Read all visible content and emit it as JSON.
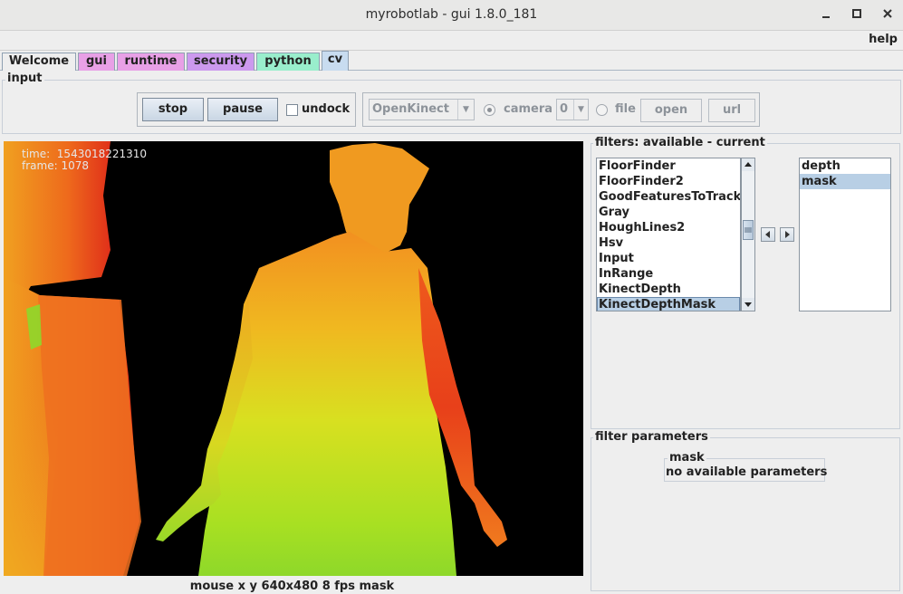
{
  "window": {
    "title": "myrobotlab - gui 1.8.0_181",
    "minimize_glyph": "✕",
    "maximize_glyph": "◻",
    "close_glyph": "✕"
  },
  "menu": {
    "help_label": "help"
  },
  "tabs": [
    {
      "label": "Welcome",
      "color": "#eeeeee",
      "active": false
    },
    {
      "label": "gui",
      "color": "#e8a0e6",
      "active": false
    },
    {
      "label": "runtime",
      "color": "#e8a0e6",
      "active": false
    },
    {
      "label": "security",
      "color": "#cc99ee",
      "active": false
    },
    {
      "label": "python",
      "color": "#99eecc",
      "active": false
    },
    {
      "label": "cv",
      "color": "#c8dcf0",
      "active": true
    }
  ],
  "input": {
    "legend": "input",
    "stop_label": "stop",
    "pause_label": "pause",
    "undock_label": "undock",
    "grabber_value": "OpenKinect",
    "camera_label": "camera",
    "camera_index": "0",
    "file_label": "file",
    "open_label": "open",
    "url_label": "url"
  },
  "video": {
    "time_label": "time:",
    "time_value": "1543018221310",
    "frame_label": "frame:",
    "frame_value": "1078"
  },
  "status": {
    "text": "mouse x y  640x480  8 fps  mask"
  },
  "filters": {
    "legend": "filters: available - current",
    "available": [
      "FloorFinder",
      "FloorFinder2",
      "GoodFeaturesToTrack",
      "Gray",
      "HoughLines2",
      "Hsv",
      "Input",
      "InRange",
      "KinectDepth",
      "KinectDepthMask"
    ],
    "available_selected": "KinectDepthMask",
    "current": [
      "depth",
      "mask"
    ],
    "current_selected": "mask"
  },
  "params": {
    "legend": "filter parameters",
    "mask_legend": "mask",
    "mask_text": "no available parameters"
  },
  "colors": {
    "selection": "#b8cfe5",
    "depth_near": "#e52a1a",
    "depth_mid": "#f0c81c",
    "depth_far": "#8ed82a"
  }
}
